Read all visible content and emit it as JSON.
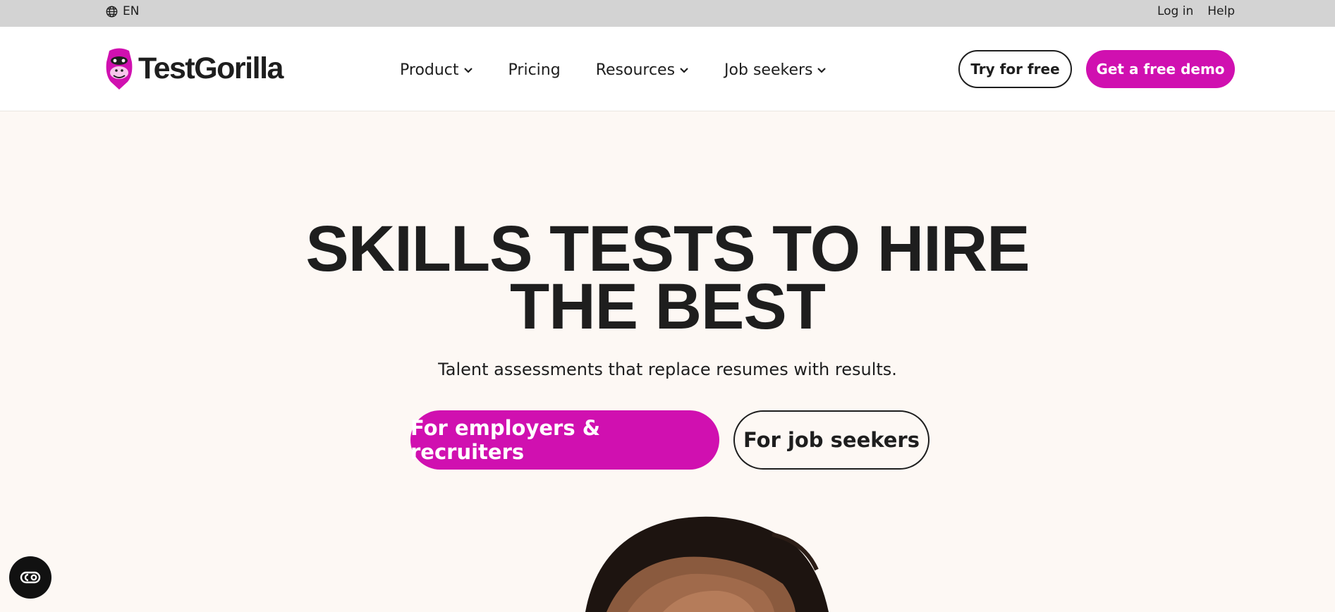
{
  "topbar": {
    "language": "EN",
    "login_label": "Log in",
    "help_label": "Help"
  },
  "brand": {
    "name": "TestGorilla",
    "accent_color": "#d010b0",
    "text_color": "#1e1e1e",
    "background": "#fdf8f4"
  },
  "nav": {
    "items": [
      {
        "label": "Product",
        "has_dropdown": true
      },
      {
        "label": "Pricing",
        "has_dropdown": false
      },
      {
        "label": "Resources",
        "has_dropdown": true
      },
      {
        "label": "Job seekers",
        "has_dropdown": true
      }
    ],
    "try_label": "Try for free",
    "demo_label": "Get a free demo"
  },
  "hero": {
    "title_line1": "SKILLS TESTS TO HIRE",
    "title_line2": "THE BEST",
    "subtitle": "Talent assessments that replace resumes with results.",
    "cta_employers": "For employers & recruiters",
    "cta_seekers": "For job seekers"
  },
  "icons": {
    "language": "globe-icon",
    "dropdown": "chevron-down-icon",
    "logo": "gorilla-logo-icon",
    "cookie": "cookie-settings-icon"
  }
}
